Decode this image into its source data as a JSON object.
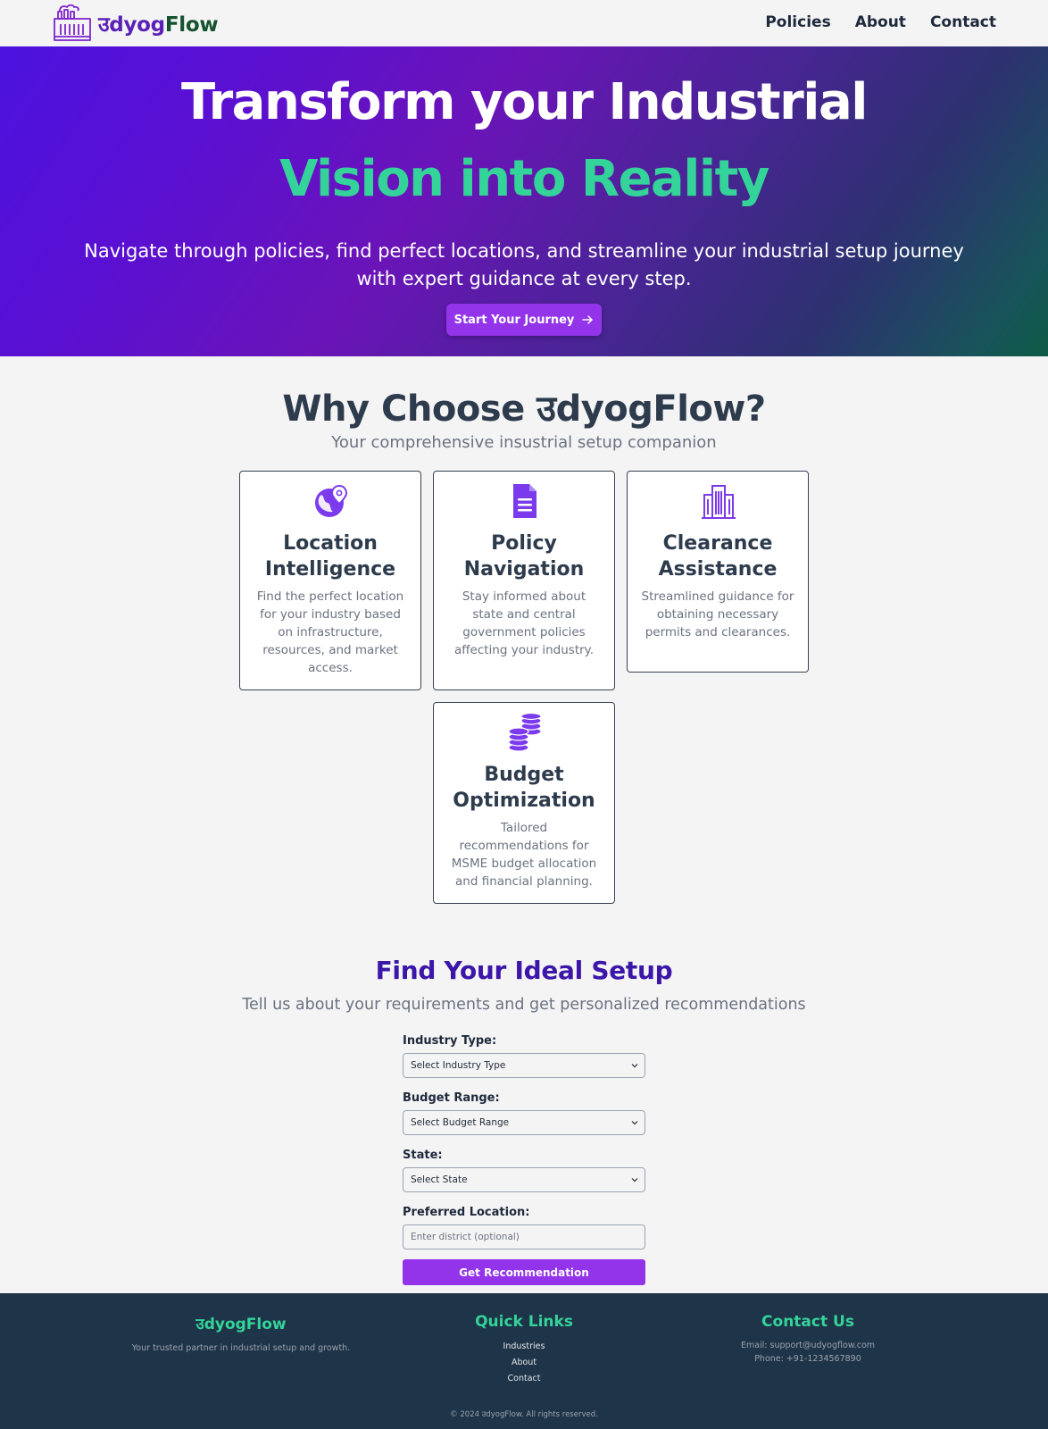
{
  "nav": {
    "brand_part1": "उdyog",
    "brand_part2": "Flow",
    "links": [
      "Policies",
      "About",
      "Contact"
    ]
  },
  "hero": {
    "title_line1": "Transform your Industrial",
    "title_line2": "Vision into Reality",
    "subtitle": "Navigate through policies, find perfect locations, and streamline your industrial setup journey with expert guidance at every step.",
    "cta_label": "Start Your Journey",
    "cta_icon": "arrow-right-icon"
  },
  "why": {
    "title": "Why Choose उdyogFlow?",
    "subtitle": "Your comprehensive insustrial setup companion",
    "cards": [
      {
        "icon": "globe-location-icon",
        "title": "Location Intelligence",
        "desc": "Find the perfect location for your industry based on infrastructure, resources, and market access."
      },
      {
        "icon": "document-icon",
        "title": "Policy Navigation",
        "desc": "Stay informed about state and central government policies affecting your industry."
      },
      {
        "icon": "building-icon",
        "title": "Clearance Assistance",
        "desc": "Streamlined guidance for obtaining necessary permits and clearances."
      },
      {
        "icon": "coins-icon",
        "title": "Budget Optimization",
        "desc": "Tailored recommendations for MSME budget allocation and financial planning."
      }
    ]
  },
  "setup": {
    "title": "Find Your Ideal Setup",
    "subtitle": "Tell us about your requirements and get personalized recommendations",
    "fields": {
      "industry_label": "Industry Type:",
      "industry_value": "Select Industry Type",
      "budget_label": "Budget Range:",
      "budget_value": "Select Budget Range",
      "state_label": "State:",
      "state_value": "Select State",
      "location_label": "Preferred Location:",
      "location_placeholder": "Enter district (optional)"
    },
    "submit_label": "Get Recommendation"
  },
  "footer": {
    "brand": "उdyogFlow",
    "tagline": "Your trusted partner in industrial setup and growth.",
    "quick_links_title": "Quick Links",
    "quick_links": [
      "Industries",
      "About",
      "Contact"
    ],
    "contact_title": "Contact Us",
    "email": "Email: support@udyogflow.com",
    "phone": "Phone: +91-1234567890",
    "copyright": "© 2024 उdyogFlow. All rights reserved."
  },
  "colors": {
    "accent_purple": "#9333ea",
    "brand_green": "#34d399",
    "footer_bg": "#1e3448"
  }
}
